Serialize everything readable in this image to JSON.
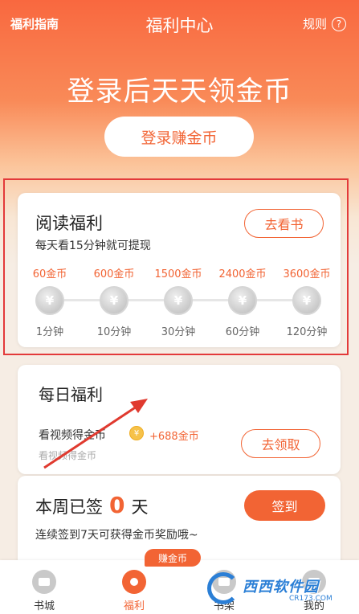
{
  "header": {
    "guide_label": "福利指南",
    "title": "福利中心",
    "rules_label": "规则",
    "rules_icon": "?"
  },
  "hero": {
    "headline": "登录后天天领金币",
    "login_button": "登录赚金币"
  },
  "reading": {
    "title": "阅读福利",
    "subtitle": "每天看15分钟就可提现",
    "button": "去看书",
    "coin_symbol": "¥",
    "steps": [
      {
        "amount": "60金币",
        "duration": "1分钟"
      },
      {
        "amount": "600金币",
        "duration": "10分钟"
      },
      {
        "amount": "1500金币",
        "duration": "30分钟"
      },
      {
        "amount": "2400金币",
        "duration": "60分钟"
      },
      {
        "amount": "3600金币",
        "duration": "120分钟"
      }
    ]
  },
  "daily": {
    "title": "每日福利",
    "task_label": "看视频得金币",
    "coin_symbol": "¥",
    "reward": "+688金币",
    "task_sub": "看视频得金币",
    "button": "去领取"
  },
  "checkin": {
    "prefix": "本周已签",
    "days": "0",
    "suffix": "天",
    "subtitle": "连续签到7天可获得金币奖励哦~",
    "button": "签到"
  },
  "nav": {
    "earn_badge": "赚金币",
    "items": [
      {
        "label": "书城"
      },
      {
        "label": "福利"
      },
      {
        "label": "书架"
      },
      {
        "label": "我的"
      }
    ]
  },
  "watermark": {
    "text": "西西软件园",
    "sub": "CR173.COM"
  },
  "colors": {
    "accent": "#f26434",
    "highlight_frame": "#e33a3a",
    "annotation_arrow": "#e03a2f"
  }
}
